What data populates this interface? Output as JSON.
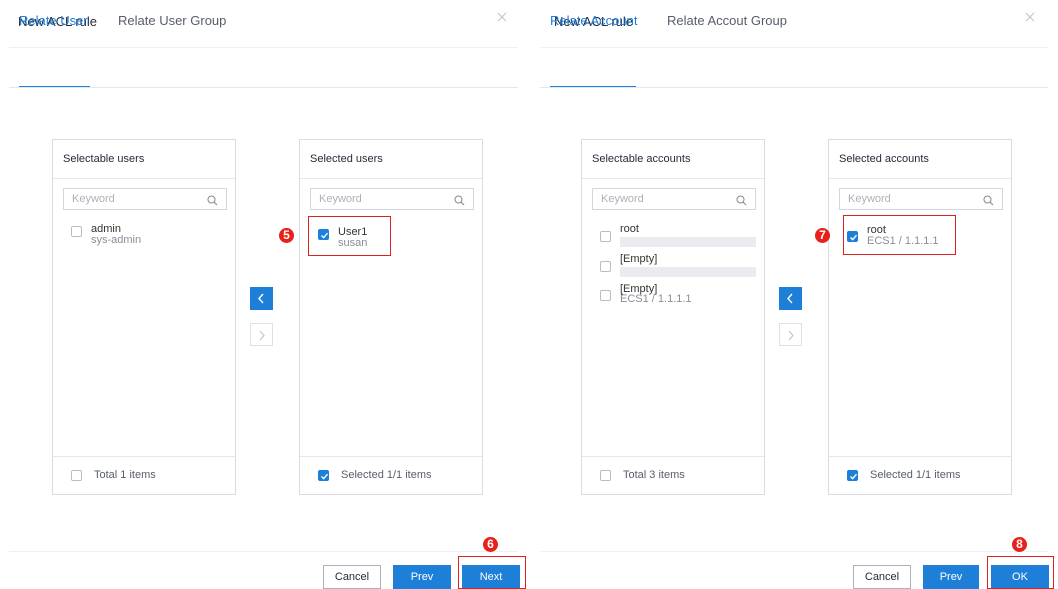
{
  "left_dialog": {
    "title": "New ACL rule",
    "tabs": [
      {
        "label": "Relate User",
        "active": true
      },
      {
        "label": "Relate User Group",
        "active": false
      }
    ],
    "source_panel": {
      "title": "Selectable users",
      "search_placeholder": "Keyword",
      "items": [
        {
          "name": "admin",
          "sub": "sys-admin",
          "checked": false
        }
      ],
      "footer": "Total 1 items"
    },
    "target_panel": {
      "title": "Selected users",
      "search_placeholder": "Keyword",
      "items": [
        {
          "name": "User1",
          "sub": "susan",
          "checked": true
        }
      ],
      "footer": "Selected 1/1 items"
    },
    "buttons": {
      "cancel": "Cancel",
      "prev": "Prev",
      "next": "Next"
    },
    "markers": {
      "item": "5",
      "button": "6"
    }
  },
  "right_dialog": {
    "title": "New ACL rule",
    "tabs": [
      {
        "label": "Relate Account",
        "active": true
      },
      {
        "label": "Relate Accout Group",
        "active": false
      }
    ],
    "source_panel": {
      "title": "Selectable accounts",
      "search_placeholder": "Keyword",
      "items": [
        {
          "name": "root",
          "sub": "",
          "checked": false
        },
        {
          "name": "[Empty]",
          "sub": "",
          "checked": false
        },
        {
          "name": "[Empty]",
          "sub": "ECS1 / 1.1.1.1",
          "checked": false
        }
      ],
      "footer": "Total 3 items"
    },
    "target_panel": {
      "title": "Selected accounts",
      "search_placeholder": "Keyword",
      "items": [
        {
          "name": "root",
          "sub": "ECS1 / 1.1.1.1",
          "checked": true
        }
      ],
      "footer": "Selected 1/1 items"
    },
    "buttons": {
      "cancel": "Cancel",
      "prev": "Prev",
      "ok": "OK"
    },
    "markers": {
      "item": "7",
      "button": "8"
    }
  },
  "colors": {
    "accent": "#1e7fd8",
    "highlight": "#e0201f",
    "marker": "#e8201a"
  },
  "icons": [
    "close-icon",
    "search-icon",
    "chevron-left-icon",
    "chevron-right-icon",
    "check-icon"
  ]
}
